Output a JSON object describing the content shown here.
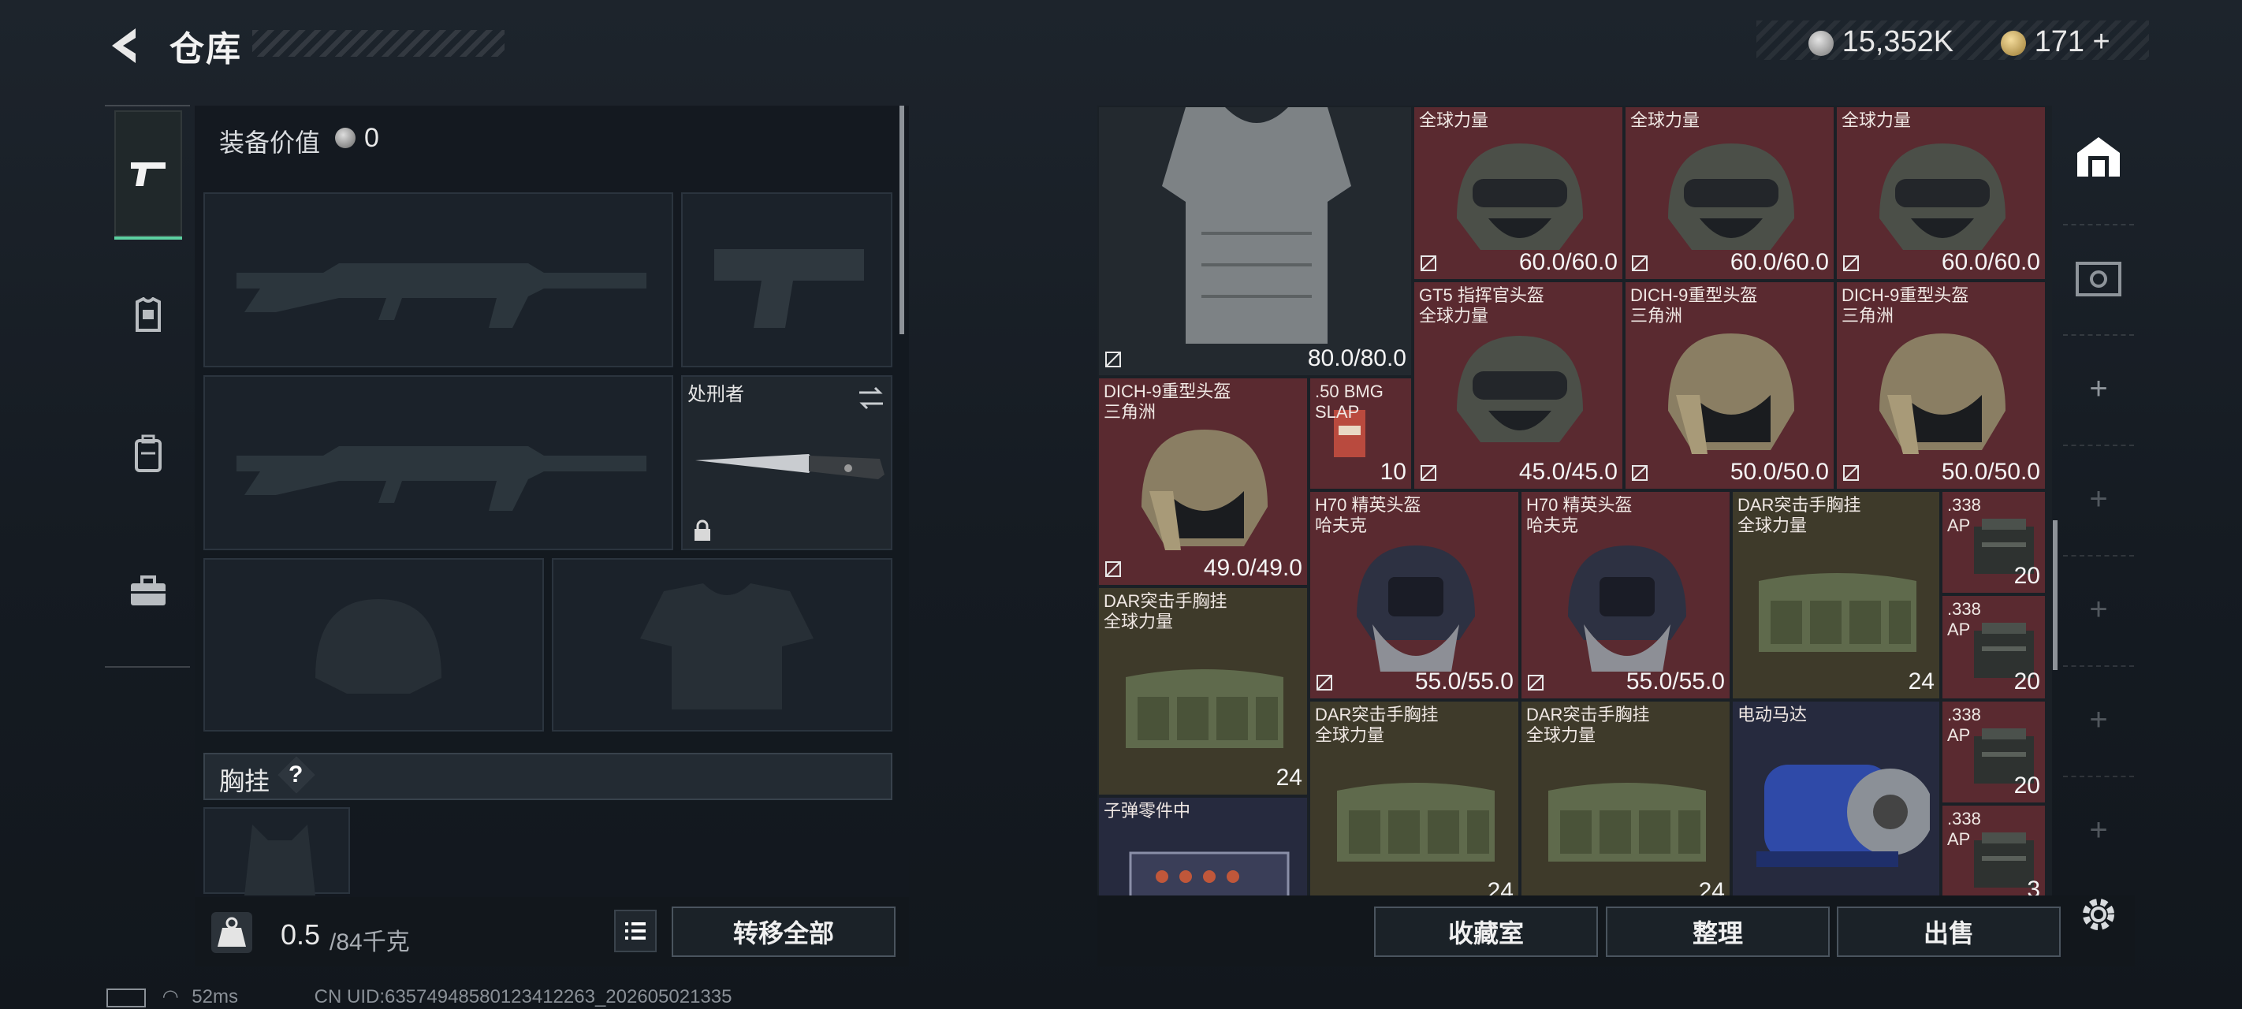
{
  "header": {
    "title": "仓库",
    "silver": "15,352K",
    "gold": "171"
  },
  "left": {
    "equip_label": "装备价值",
    "equip_value": "0",
    "melee_name": "处刑者",
    "chest_label": "胸挂",
    "chest_help": "?",
    "weight_value": "0.5",
    "weight_max": "/84千克",
    "transfer_all": "转移全部"
  },
  "status": {
    "ping": "52ms",
    "uid": "CN UID:63574948580123412263_202605021335"
  },
  "grid": {
    "items": [
      {
        "id": "vest",
        "name": "",
        "dur": "80.0/80.0",
        "type": "vest",
        "bg": "dark"
      },
      {
        "id": "h1",
        "name": "全球力量",
        "dur": "60.0/60.0",
        "type": "helmet-green",
        "bg": "red"
      },
      {
        "id": "h2",
        "name": "全球力量",
        "dur": "60.0/60.0",
        "type": "helmet-green",
        "bg": "red"
      },
      {
        "id": "h3",
        "name": "全球力量",
        "dur": "60.0/60.0",
        "type": "helmet-green",
        "bg": "red"
      },
      {
        "id": "gt5",
        "name": "GT5 指挥官头盔\n全球力量",
        "dur": "45.0/45.0",
        "type": "helmet-green",
        "bg": "red"
      },
      {
        "id": "dich1",
        "name": "DICH-9重型头盔\n三角洲",
        "dur": "50.0/50.0",
        "type": "helmet-tan",
        "bg": "red"
      },
      {
        "id": "dich2",
        "name": "DICH-9重型头盔\n三角洲",
        "dur": "50.0/50.0",
        "type": "helmet-tan",
        "bg": "red"
      },
      {
        "id": "dich3",
        "name": "DICH-9重型头盔\n三角洲",
        "dur": "49.0/49.0",
        "type": "helmet-tan",
        "bg": "red"
      },
      {
        "id": "bmg",
        "name": ".50 BMG\nSLAP",
        "dur": "10",
        "type": "ammo-box",
        "bg": "red"
      },
      {
        "id": "h70a",
        "name": "H70 精英头盔\n哈夫克",
        "dur": "55.0/55.0",
        "type": "helmet-navy",
        "bg": "red"
      },
      {
        "id": "h70b",
        "name": "H70 精英头盔\n哈夫克",
        "dur": "55.0/55.0",
        "type": "helmet-navy",
        "bg": "red"
      },
      {
        "id": "dar1",
        "name": "DAR突击手胸挂\n全球力量",
        "dur": "24",
        "type": "rig",
        "bg": "olive"
      },
      {
        "id": "dar2",
        "name": "DAR突击手胸挂\n全球力量",
        "dur": "24",
        "type": "rig",
        "bg": "olive"
      },
      {
        "id": "dar3",
        "name": "DAR突击手胸挂\n全球力量",
        "dur": "24",
        "type": "rig",
        "bg": "olive"
      },
      {
        "id": "dar4",
        "name": "DAR突击手胸挂\n全球力量",
        "dur": "24",
        "type": "rig",
        "bg": "olive"
      },
      {
        "id": "motor",
        "name": "电动马达",
        "dur": "",
        "type": "motor",
        "bg": "navy"
      },
      {
        "id": "parts",
        "name": "子弹零件中",
        "dur": "",
        "type": "parts",
        "bg": "navy"
      },
      {
        "id": "ap1",
        "name": ".338\nAP",
        "dur": "20",
        "type": "ammo-can",
        "bg": "red"
      },
      {
        "id": "ap2",
        "name": ".338\nAP",
        "dur": "20",
        "type": "ammo-can",
        "bg": "red"
      },
      {
        "id": "ap3",
        "name": ".338\nAP",
        "dur": "20",
        "type": "ammo-can",
        "bg": "red"
      },
      {
        "id": "ap4",
        "name": ".338\nAP",
        "dur": "3",
        "type": "ammo-can",
        "bg": "red"
      }
    ]
  },
  "buttons": {
    "collection": "收藏室",
    "sort": "整理",
    "sell": "出售"
  },
  "colors": {
    "accent": "#5cd0a0",
    "red_cell": "#5a2a30",
    "olive_cell": "#3e3a2a"
  }
}
